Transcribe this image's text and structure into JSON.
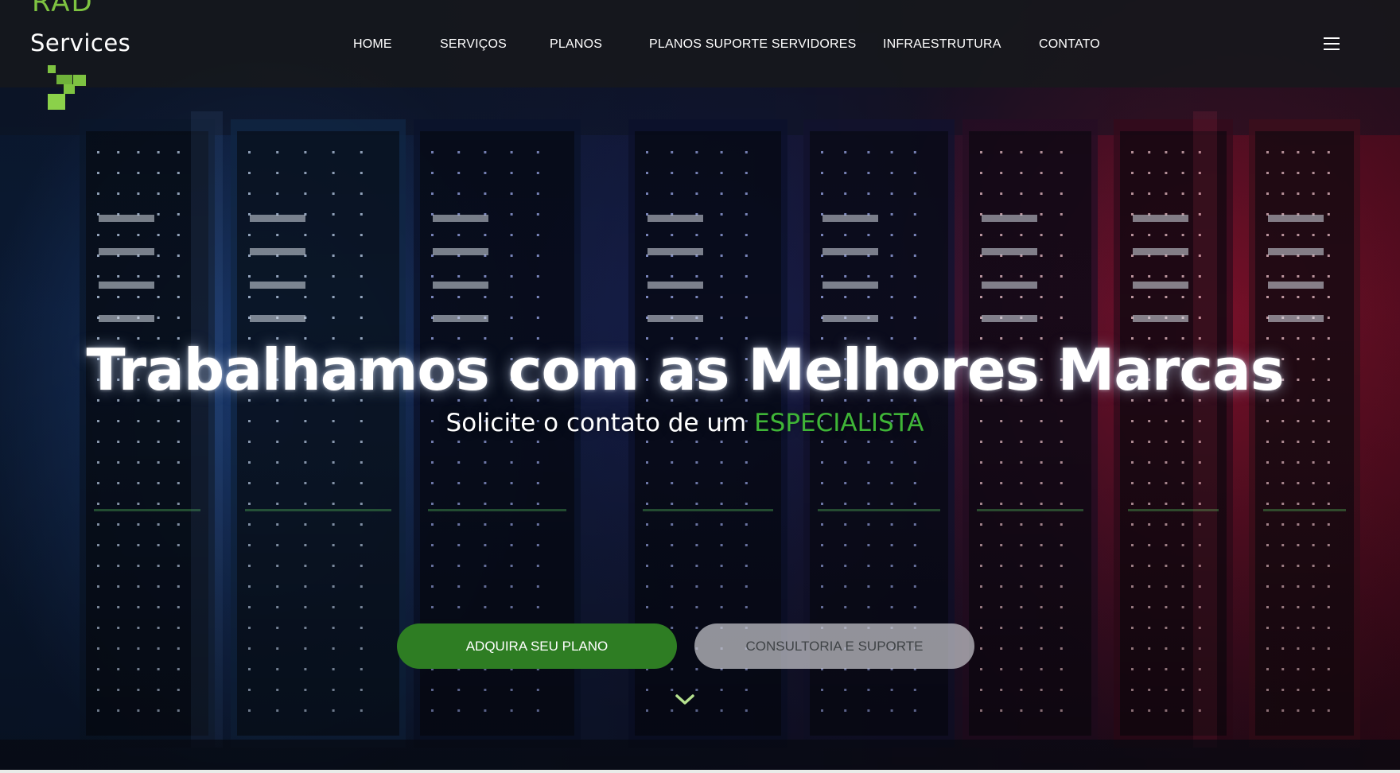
{
  "header": {
    "logo": {
      "line1": "RAD",
      "line2": "Services"
    },
    "nav": [
      {
        "label": "HOME"
      },
      {
        "label": "SERVIÇOS"
      },
      {
        "label": "PLANOS"
      },
      {
        "label": "PLANOS SUPORTE SERVIDORES"
      },
      {
        "label": "INFRAESTRUTURA"
      },
      {
        "label": "CONTATO"
      }
    ],
    "menu_icon": "hamburger-menu-icon"
  },
  "hero": {
    "title": "Trabalhamos com as Melhores Marcas",
    "subtitle_prefix": "Solicite o contato de um ",
    "subtitle_accent": "ESPECIALISTA",
    "buttons": {
      "primary": "ADQUIRA SEU PLANO",
      "secondary": "CONSULTORIA E SUPORTE"
    },
    "scroll_icon": "chevron-down-icon"
  },
  "colors": {
    "brand_green": "#7ec341",
    "accent_green": "#3fb537",
    "button_green": "#2e7d23",
    "header_bg": "#16181c"
  }
}
